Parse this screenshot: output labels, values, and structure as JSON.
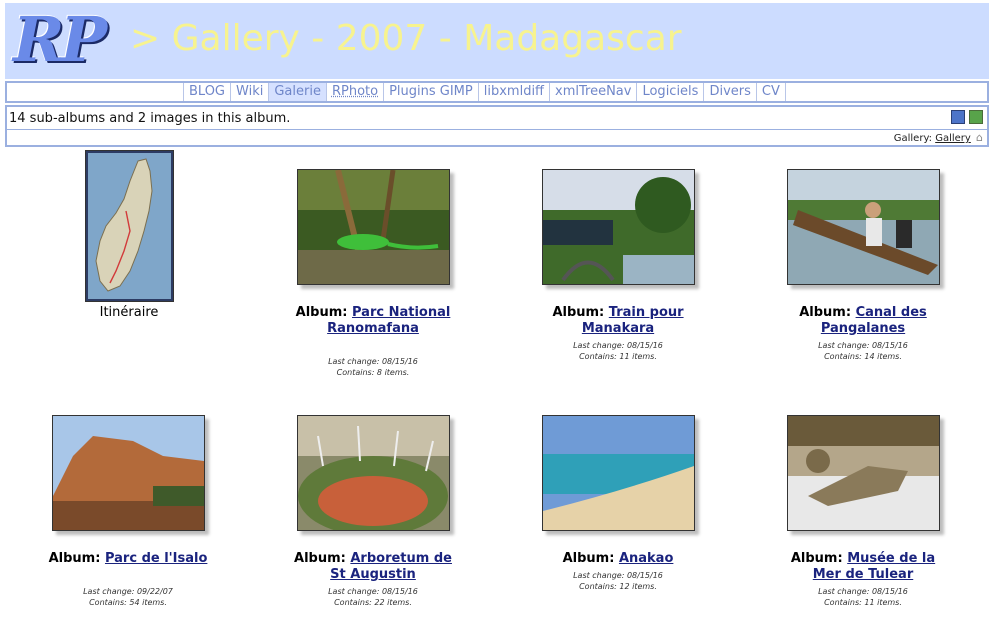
{
  "header": {
    "logo": "RP",
    "title": "> Gallery - 2007 - Madagascar"
  },
  "nav": {
    "items": [
      {
        "label": "BLOG"
      },
      {
        "label": "Wiki"
      },
      {
        "label": "Galerie",
        "active": true
      },
      {
        "label": "RPhoto"
      },
      {
        "label": "Plugins GIMP"
      },
      {
        "label": "libxmldiff"
      },
      {
        "label": "xmlTreeNav"
      },
      {
        "label": "Logiciels"
      },
      {
        "label": "Divers"
      },
      {
        "label": "CV"
      }
    ]
  },
  "info": {
    "summary": "14 sub-albums and 2 images in this album.",
    "breadcrumb_prefix": "Gallery:",
    "breadcrumb_link": "Gallery"
  },
  "image_item": {
    "caption": "Itinéraire"
  },
  "albums": [
    {
      "prefix": "Album:",
      "name": "Parc National Ranomafana",
      "last_change": "Last change: 08/15/16",
      "contains": "Contains: 8 items."
    },
    {
      "prefix": "Album:",
      "name": "Train pour Manakara",
      "last_change": "Last change: 08/15/16",
      "contains": "Contains: 11 items."
    },
    {
      "prefix": "Album:",
      "name": "Canal des Pangalanes",
      "last_change": "Last change: 08/15/16",
      "contains": "Contains: 14 items."
    },
    {
      "prefix": "Album:",
      "name": "Parc de l'Isalo",
      "last_change": "Last change: 09/22/07",
      "contains": "Contains: 54 items."
    },
    {
      "prefix": "Album:",
      "name": "Arboretum de St Augustin",
      "last_change": "Last change: 08/15/16",
      "contains": "Contains: 22 items."
    },
    {
      "prefix": "Album:",
      "name": "Anakao",
      "last_change": "Last change: 08/15/16",
      "contains": "Contains: 12 items."
    },
    {
      "prefix": "Album:",
      "name": "Musée de la Mer de Tulear",
      "last_change": "Last change: 08/15/16",
      "contains": "Contains: 11 items."
    }
  ]
}
